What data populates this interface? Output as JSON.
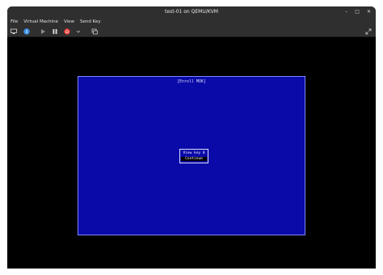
{
  "window": {
    "title": "test-01 on QEMU/KVM",
    "controls": [
      "–",
      "□",
      "✕"
    ]
  },
  "menu": {
    "items": [
      "File",
      "Virtual Machine",
      "View",
      "Send Key"
    ]
  },
  "toolbar": {
    "buttons": [
      {
        "name": "console",
        "icon": "monitor-icon"
      },
      {
        "name": "details",
        "icon": "info-icon"
      },
      {
        "name": "run",
        "icon": "play-icon"
      },
      {
        "name": "pause",
        "icon": "pause-icon"
      },
      {
        "name": "shutdown",
        "icon": "power-icon"
      },
      {
        "name": "shutdown-menu",
        "icon": "chevron-down-icon"
      },
      {
        "name": "snapshots",
        "icon": "snapshot-icon"
      },
      {
        "name": "fullscreen",
        "icon": "fullscreen-icon"
      }
    ]
  },
  "guest": {
    "frame_title": "[Enroll MOK]",
    "options": [
      "View key 0",
      "Continue"
    ]
  },
  "colors": {
    "blue_bg": "#0a0aa8",
    "frame_border": "#7d86ff",
    "titlebar": "#2f2f2f"
  }
}
